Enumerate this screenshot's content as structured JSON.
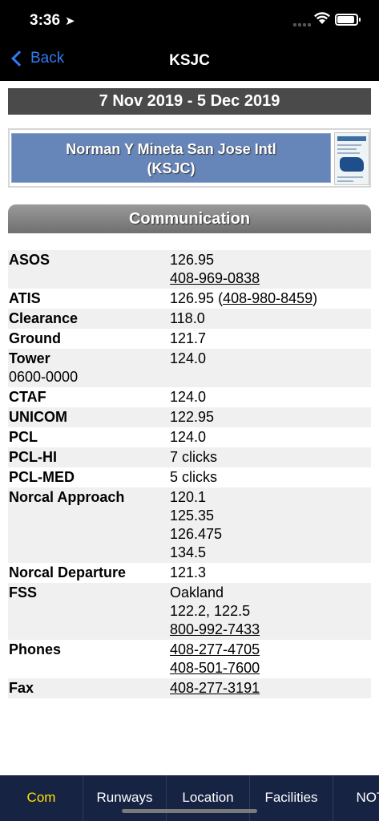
{
  "status_bar": {
    "time": "3:36"
  },
  "nav": {
    "back_label": "Back",
    "title": "KSJC"
  },
  "date_range": "7 Nov 2019 - 5 Dec 2019",
  "airport": {
    "name_line1": "Norman Y Mineta San Jose Intl",
    "name_line2": "(KSJC)"
  },
  "section_title": "Communication",
  "rows": [
    {
      "label": "ASOS",
      "values": [
        "126.95",
        "408-969-0838"
      ]
    },
    {
      "label": "ATIS",
      "values": [
        "126.95"
      ],
      "phone": "408-980-8459"
    },
    {
      "label": "Clearance",
      "values": [
        "118.0"
      ]
    },
    {
      "label": "Ground",
      "values": [
        "121.7"
      ]
    },
    {
      "label": "Tower",
      "note": "0600-0000",
      "values": [
        "124.0"
      ]
    },
    {
      "label": "CTAF",
      "values": [
        "124.0"
      ]
    },
    {
      "label": "UNICOM",
      "values": [
        "122.95"
      ]
    },
    {
      "label": "PCL",
      "values": [
        "124.0"
      ]
    },
    {
      "label": "PCL-HI",
      "values": [
        "7 clicks"
      ]
    },
    {
      "label": "PCL-MED",
      "values": [
        "5 clicks"
      ]
    },
    {
      "label": "Norcal Approach",
      "values": [
        "120.1",
        "125.35",
        "126.475",
        "134.5"
      ]
    },
    {
      "label": "Norcal Departure",
      "values": [
        "121.3"
      ]
    },
    {
      "label": "FSS",
      "values": [
        "Oakland",
        "122.2, 122.5",
        "800-992-7433"
      ]
    },
    {
      "label": "Phones",
      "values": [
        "408-277-4705",
        "408-501-7600"
      ]
    },
    {
      "label": "Fax",
      "values": [
        "408-277-3191"
      ]
    }
  ],
  "tabs": [
    {
      "label": "Com",
      "active": true
    },
    {
      "label": "Runways"
    },
    {
      "label": "Location"
    },
    {
      "label": "Facilities"
    },
    {
      "label": "NOTA"
    }
  ],
  "colors": {
    "accent": "#2f7bf6",
    "tab_active": "#ffe300",
    "tab_bar": "#162343",
    "airport_banner": "#6685b8"
  }
}
